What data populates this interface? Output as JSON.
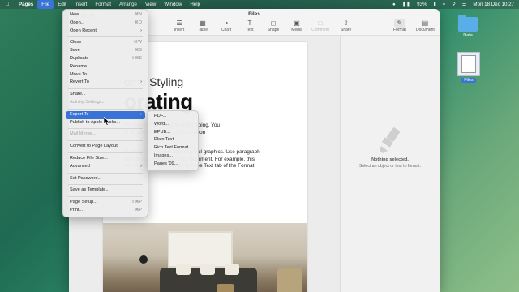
{
  "menubar": {
    "apple_icon": "apple-logo",
    "app": "Pages",
    "items": [
      "File",
      "Edit",
      "Insert",
      "Format",
      "Arrange",
      "View",
      "Window",
      "Help"
    ],
    "battery": "93%",
    "datetime": "Mon 18 Dec  10:27"
  },
  "desktop": {
    "items": [
      {
        "label": "Data",
        "icon": "folder-icon"
      },
      {
        "label": "Files",
        "icon": "document-icon"
      }
    ]
  },
  "window": {
    "title": "Files",
    "toolbar": [
      {
        "label": "Insert",
        "icon": "insert-icon"
      },
      {
        "label": "Table",
        "icon": "table-icon"
      },
      {
        "label": "Chart",
        "icon": "chart-icon"
      },
      {
        "label": "Text",
        "icon": "text-icon"
      },
      {
        "label": "Shape",
        "icon": "shape-icon"
      },
      {
        "label": "Media",
        "icon": "media-icon"
      },
      {
        "label": "Comment",
        "icon": "comment-icon"
      }
    ],
    "share": "Share",
    "format": "Format",
    "document": "Document"
  },
  "page": {
    "subtitle": "ome Styling",
    "heading": "orating",
    "para1": "his placeholder text and begin typing. You\nnt on your Mac, iPad, iPhone, or on",
    "para2": "xt, change fonts and add beautiful graphics. Use paragraph\nsistent look throughout your document. For example, this\nody style. You can change it in the Text tab of the Format"
  },
  "sidebar": {
    "no_selection": "Nothing selected.",
    "hint": "Select an object or text to format."
  },
  "file_menu": [
    {
      "label": "New...",
      "shortcut": "⌘N"
    },
    {
      "label": "Open...",
      "shortcut": "⌘O"
    },
    {
      "label": "Open Recent",
      "submenu": true
    },
    {
      "sep": true
    },
    {
      "label": "Close",
      "shortcut": "⌘W"
    },
    {
      "label": "Save",
      "shortcut": "⌘S"
    },
    {
      "label": "Duplicate",
      "shortcut": "⇧⌘S"
    },
    {
      "label": "Rename..."
    },
    {
      "label": "Move To..."
    },
    {
      "label": "Revert To",
      "submenu": true
    },
    {
      "sep": true
    },
    {
      "label": "Share..."
    },
    {
      "label": "Activity Settings...",
      "disabled": true
    },
    {
      "sep": true
    },
    {
      "label": "Export To",
      "submenu": true,
      "highlight": true
    },
    {
      "label": "Publish to Apple Books..."
    },
    {
      "sep": true
    },
    {
      "label": "Mail Merge...",
      "disabled": true
    },
    {
      "sep": true
    },
    {
      "label": "Convert to Page Layout"
    },
    {
      "sep": true
    },
    {
      "label": "Reduce File Size..."
    },
    {
      "label": "Advanced",
      "submenu": true
    },
    {
      "sep": true
    },
    {
      "label": "Set Password..."
    },
    {
      "sep": true
    },
    {
      "label": "Save as Template..."
    },
    {
      "sep": true
    },
    {
      "label": "Page Setup...",
      "shortcut": "⇧⌘P"
    },
    {
      "label": "Print...",
      "shortcut": "⌘P"
    }
  ],
  "export_menu": [
    {
      "label": "PDF..."
    },
    {
      "label": "Word..."
    },
    {
      "label": "EPUB..."
    },
    {
      "label": "Plain Text..."
    },
    {
      "label": "Rich Text Format..."
    },
    {
      "label": "Images..."
    },
    {
      "label": "Pages '09..."
    }
  ],
  "colors": {
    "accent": "#3a73d6",
    "close": "#ff5f57",
    "minimize": "#febc2e",
    "zoom": "#28c840"
  }
}
